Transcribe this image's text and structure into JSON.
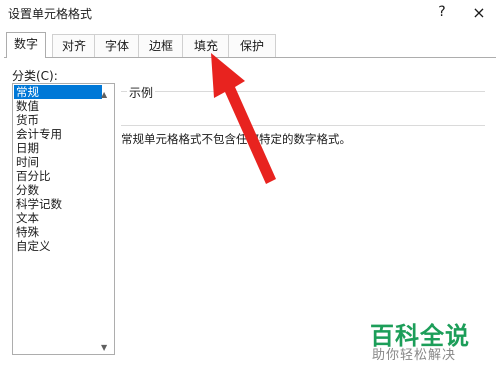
{
  "window": {
    "title": "设置单元格格式",
    "help_glyph": "?",
    "close_glyph": "×"
  },
  "tabs": [
    {
      "label": "数字",
      "active": true
    },
    {
      "label": "对齐",
      "active": false
    },
    {
      "label": "字体",
      "active": false
    },
    {
      "label": "边框",
      "active": false
    },
    {
      "label": "填充",
      "active": false
    },
    {
      "label": "保护",
      "active": false
    }
  ],
  "category": {
    "label": "分类(C):",
    "items": [
      "常规",
      "数值",
      "货币",
      "会计专用",
      "日期",
      "时间",
      "百分比",
      "分数",
      "科学记数",
      "文本",
      "特殊",
      "自定义"
    ],
    "selected": "常规"
  },
  "sample": {
    "legend": "示例"
  },
  "description": "常规单元格格式不包含任何特定的数字格式。",
  "annotation": {
    "arrow_color": "#e8231f"
  },
  "watermark": {
    "title": "百科全说",
    "subtitle": "助你轻松解决"
  }
}
